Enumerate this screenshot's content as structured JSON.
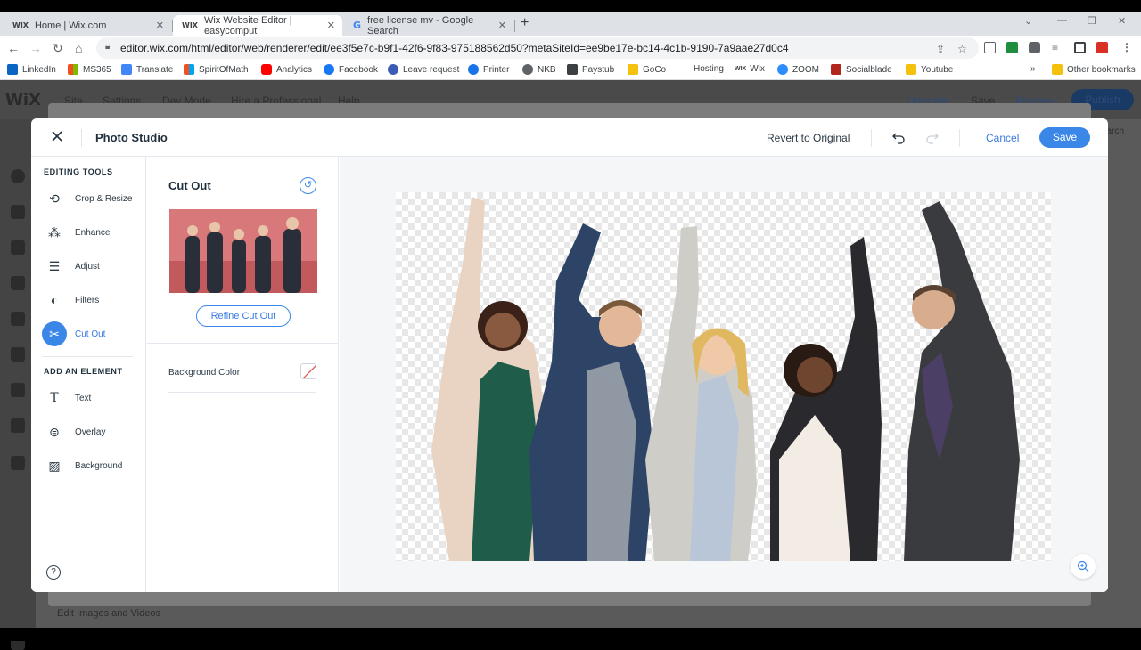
{
  "browser": {
    "tabs": [
      {
        "favicon": "WIX",
        "title": "Home | Wix.com"
      },
      {
        "favicon": "WIX",
        "title": "Wix Website Editor | easycomput"
      },
      {
        "favicon": "G",
        "title": "free license mv - Google Search"
      }
    ],
    "url": "editor.wix.com/html/editor/web/renderer/edit/ee3f5e7c-b9f1-42f6-9f83-975188562d50?metaSiteId=ee9be17e-bc14-4c1b-9190-7a9aae27d0c4",
    "bookmarks": [
      "LinkedIn",
      "MS365",
      "Translate",
      "SpiritOfMath",
      "Analytics",
      "Facebook",
      "Leave request",
      "Printer",
      "NKB",
      "Paystub",
      "GoCo",
      "Hosting",
      "Wix",
      "ZOOM",
      "Socialblade",
      "Youtube"
    ],
    "bookmarks_more": "»",
    "other_bookmarks": "Other bookmarks"
  },
  "editor": {
    "logo": "WiX",
    "menu": [
      "Site",
      "Settings",
      "Dev Mode",
      "Hire a Professional",
      "Help"
    ],
    "right_menu": [
      "Upgrade",
      "Save",
      "Preview"
    ],
    "publish": "Publish",
    "search": "earch",
    "bottom_label": "Edit Images and Videos"
  },
  "modal": {
    "title": "Photo Studio",
    "revert": "Revert to Original",
    "cancel": "Cancel",
    "save": "Save",
    "editing_tools_heading": "EDITING TOOLS",
    "tools": [
      "Crop & Resize",
      "Enhance",
      "Adjust",
      "Filters",
      "Cut Out"
    ],
    "add_element_heading": "ADD AN ELEMENT",
    "elements": [
      "Text",
      "Overlay",
      "Background"
    ],
    "help": "?",
    "panel": {
      "title": "Cut Out",
      "refine_button": "Refine Cut Out",
      "background_color_label": "Background Color"
    }
  },
  "colors": {
    "accent": "#3a87e8",
    "text_dark": "#20303c"
  }
}
